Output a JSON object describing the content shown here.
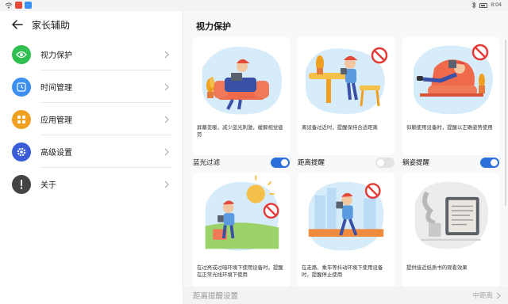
{
  "status_bar": {
    "time": "8:04"
  },
  "header": {
    "title": "家长辅助"
  },
  "menu": [
    {
      "label": "视力保护",
      "icon": "eye-icon",
      "color": "#2fbf50"
    },
    {
      "label": "时间管理",
      "icon": "clock-icon",
      "color": "#3a8ff0"
    },
    {
      "label": "应用管理",
      "icon": "apps-icon",
      "color": "#f0a020"
    },
    {
      "label": "高级设置",
      "icon": "gear-icon",
      "color": "#3a5ed8"
    },
    {
      "label": "关于",
      "icon": "exclamation-icon",
      "color": "#444444"
    }
  ],
  "main": {
    "title": "视力保护",
    "cards": [
      {
        "desc": "屏幕变暖，减少蓝光刺激，缓解视觉疲劳",
        "toggle_label": "蓝光过滤",
        "toggle_on": true
      },
      {
        "desc": "离设备过近时，提醒保持合适距离",
        "toggle_label": "距离提醒",
        "toggle_on": false
      },
      {
        "desc": "仰躺使用设备时，提醒以正确姿势使用",
        "toggle_label": "躺姿提醒",
        "toggle_on": true
      },
      {
        "desc": "在过亮或过暗环境下使用设备时，提醒在正常光线环境下使用"
      },
      {
        "desc": "在走路、乘车等抖动环境下使用设备时，提醒停止使用"
      },
      {
        "desc": "提供接近纸质书的观看效果"
      }
    ],
    "bottom": {
      "label": "距离提醒设置",
      "value": "中距离"
    }
  },
  "colors": {
    "accent": "#2a6fdb",
    "scene_blue": "#d6ecfb",
    "card_bg": "#ffffff"
  }
}
